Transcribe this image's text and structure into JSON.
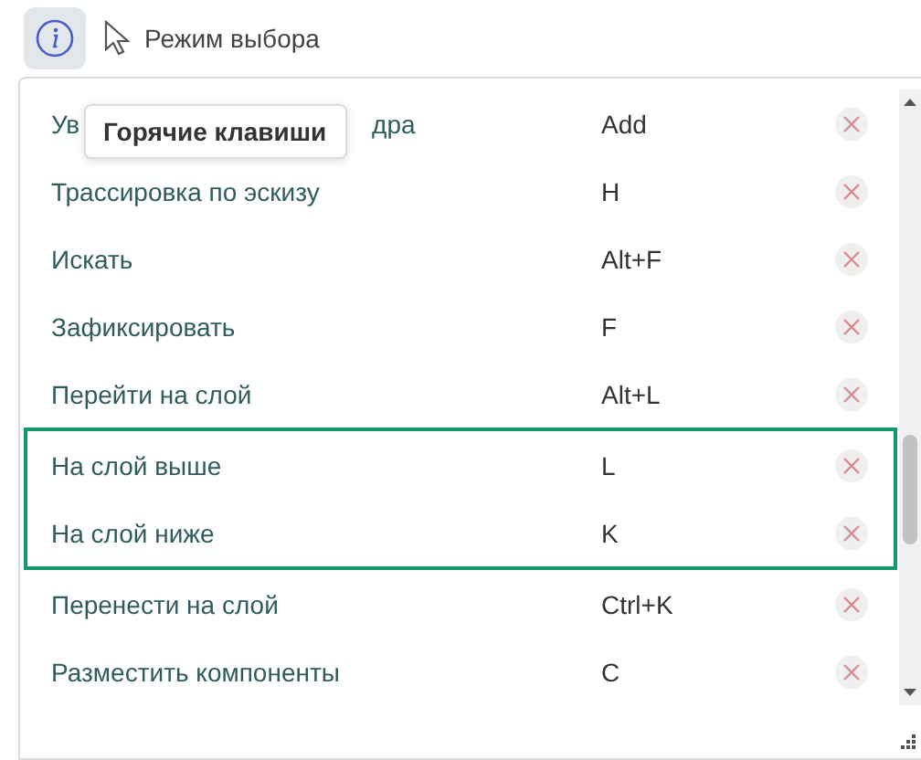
{
  "toolbar": {
    "mode_label": "Режим выбора"
  },
  "tooltip": {
    "text": "Горячие клавиши"
  },
  "shortcuts": [
    {
      "name_parts": [
        "Ув",
        "дра"
      ],
      "key": "Add",
      "highlighted": false
    },
    {
      "name": "Трассировка по эскизу",
      "key": "H",
      "highlighted": false
    },
    {
      "name": "Искать",
      "key": "Alt+F",
      "highlighted": false
    },
    {
      "name": "Зафиксировать",
      "key": "F",
      "highlighted": false
    },
    {
      "name": "Перейти на слой",
      "key": "Alt+L",
      "highlighted": false
    },
    {
      "name": "На слой выше",
      "key": "L",
      "highlighted": true
    },
    {
      "name": "На слой ниже",
      "key": "K",
      "highlighted": true
    },
    {
      "name": "Перенести на слой",
      "key": "Ctrl+K",
      "highlighted": false
    },
    {
      "name": "Разместить компоненты",
      "key": "C",
      "highlighted": false
    }
  ]
}
